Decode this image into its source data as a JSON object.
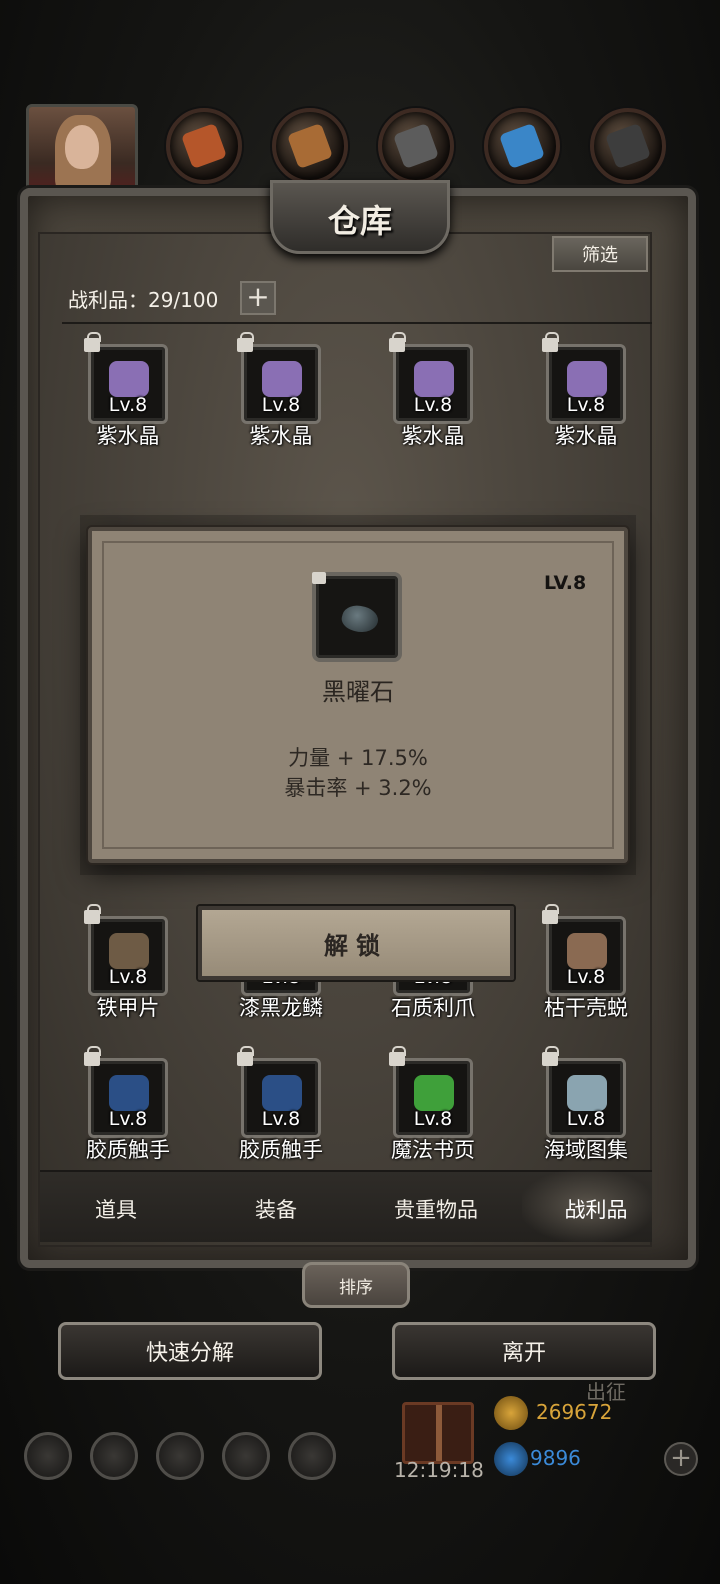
{
  "header": {
    "title": "仓库",
    "filter_label": "筛选",
    "loot_count": "战利品：29/100",
    "plus_label": "+",
    "top_icons": [
      "avatar-icon",
      "ore-icon",
      "wood-icon",
      "stone-icon",
      "crystal-icon",
      "iron-icon"
    ]
  },
  "grid": {
    "rows": [
      [
        {
          "name": "紫水晶",
          "level": "Lv.8",
          "art": "#8a6fb4"
        },
        {
          "name": "紫水晶",
          "level": "Lv.8",
          "art": "#8a6fb4"
        },
        {
          "name": "紫水晶",
          "level": "Lv.8",
          "art": "#8a6fb4"
        },
        {
          "name": "紫水晶",
          "level": "Lv.8",
          "art": "#8a6fb4"
        }
      ],
      [
        {
          "name": "铁甲片",
          "level": "Lv.8",
          "art": "#6e5b45"
        },
        {
          "name": "漆黑龙鳞",
          "level": "Lv.8",
          "art": "#2c2a29"
        },
        {
          "name": "石质利爪",
          "level": "Lv.8",
          "art": "#4a4744"
        },
        {
          "name": "枯干壳蜕",
          "level": "Lv.8",
          "art": "#8a6a52"
        }
      ],
      [
        {
          "name": "胶质触手",
          "level": "Lv.8",
          "art": "#2b4f86"
        },
        {
          "name": "胶质触手",
          "level": "Lv.8",
          "art": "#2b4f86"
        },
        {
          "name": "魔法书页",
          "level": "Lv.8",
          "art": "#3fa03a"
        },
        {
          "name": "海域图集",
          "level": "Lv.8",
          "art": "#8aa4b0"
        }
      ]
    ]
  },
  "tabs": [
    "道具",
    "装备",
    "贵重物品",
    "战利品"
  ],
  "buttons": {
    "sort": "排序",
    "quick_dismantle": "快速分解",
    "leave": "离开"
  },
  "hud": {
    "clock": "12:19:18",
    "gold": "269672",
    "gems": "9896",
    "side_text": "出征",
    "gold_color": "#d8a43a",
    "gem_color": "#3b8ad8"
  },
  "popup": {
    "level": "LV.8",
    "item_name": "黑曜石",
    "stats": [
      "力量 + 17.5%",
      "暴击率 + 3.2%"
    ],
    "unlock_label": "解锁"
  }
}
